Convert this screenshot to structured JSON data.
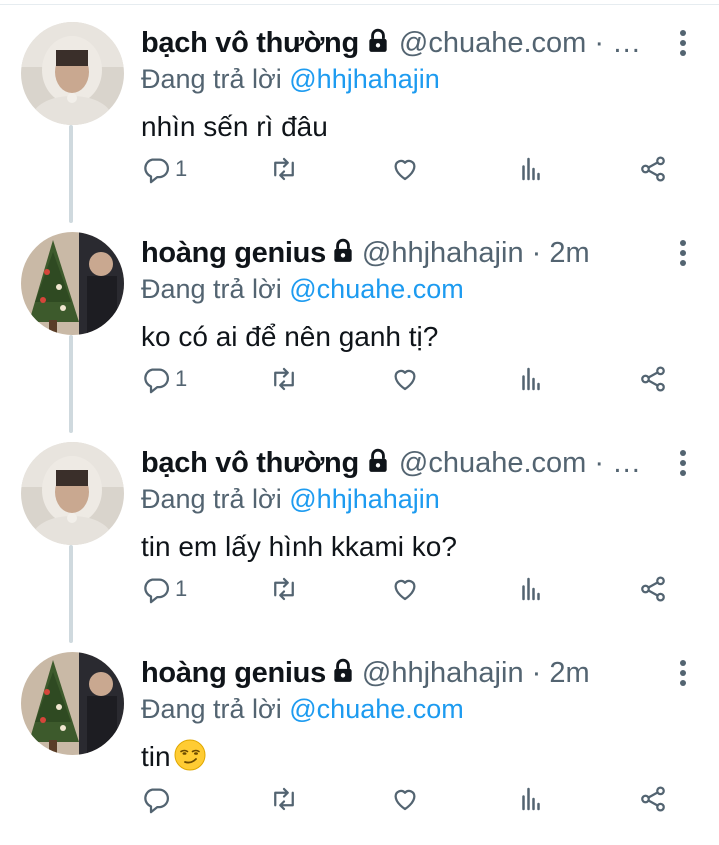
{
  "tweets": [
    {
      "name": "bạch vô thường",
      "handle": "@chuahe.com · …",
      "reply_prefix": "Đang trả lời ",
      "reply_to": "@hhjhahajin",
      "text": "nhìn sến rì đâu",
      "reply_count": "1",
      "avatar": "hooded-person"
    },
    {
      "name": "hoàng genius",
      "handle": "@hhjhahajin · 2m",
      "reply_prefix": "Đang trả lời ",
      "reply_to": "@chuahe.com",
      "text": "ko có ai để nên ganh tị?",
      "reply_count": "1",
      "avatar": "christmas-tree"
    },
    {
      "name": "bạch vô thường",
      "handle": "@chuahe.com · …",
      "reply_prefix": "Đang trả lời ",
      "reply_to": "@hhjhahajin",
      "text": "tin em lấy hình kkami ko?",
      "reply_count": "1",
      "avatar": "hooded-person"
    },
    {
      "name": "hoàng genius",
      "handle": "@hhjhahajin · 2m",
      "reply_prefix": "Đang trả lời ",
      "reply_to": "@chuahe.com",
      "text": "tin",
      "text_emoji": "smirking-face",
      "reply_count": "",
      "avatar": "christmas-tree"
    }
  ],
  "icons": {
    "reply": "reply-icon",
    "retweet": "retweet-icon",
    "like": "heart-icon",
    "analytics": "analytics-icon",
    "share": "share-icon",
    "more": "more-vertical-icon",
    "lock": "lock-icon"
  },
  "colors": {
    "text": "#0f1419",
    "secondary": "#536471",
    "link": "#1d9bf0",
    "thread_line": "#cfd9de"
  }
}
